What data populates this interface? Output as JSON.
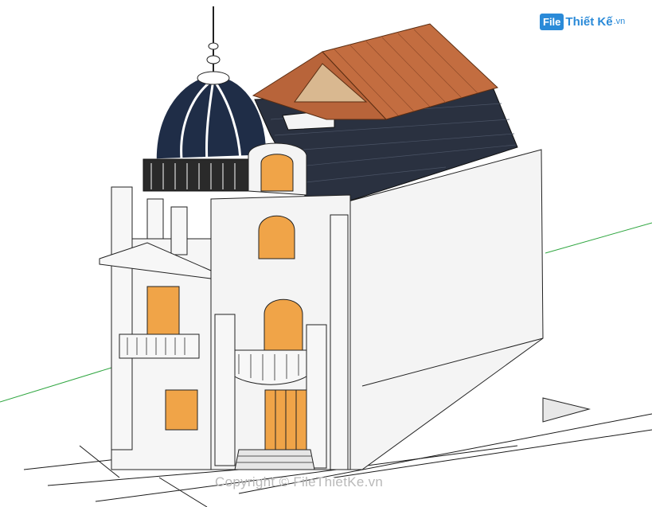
{
  "logo": {
    "badge": "File",
    "name": "Thiết Kế",
    "suffix": ".vn"
  },
  "watermark": "Copyright © FileThietKe.vn",
  "colors": {
    "dome": "#1f2d47",
    "roof_slate": "#2a3140",
    "roof_tile": "#b8643a",
    "wall": "#f4f4f4",
    "window_glass": "#f0a448",
    "ground_line": "#1a1a1a",
    "axis_green": "#2fa640"
  }
}
